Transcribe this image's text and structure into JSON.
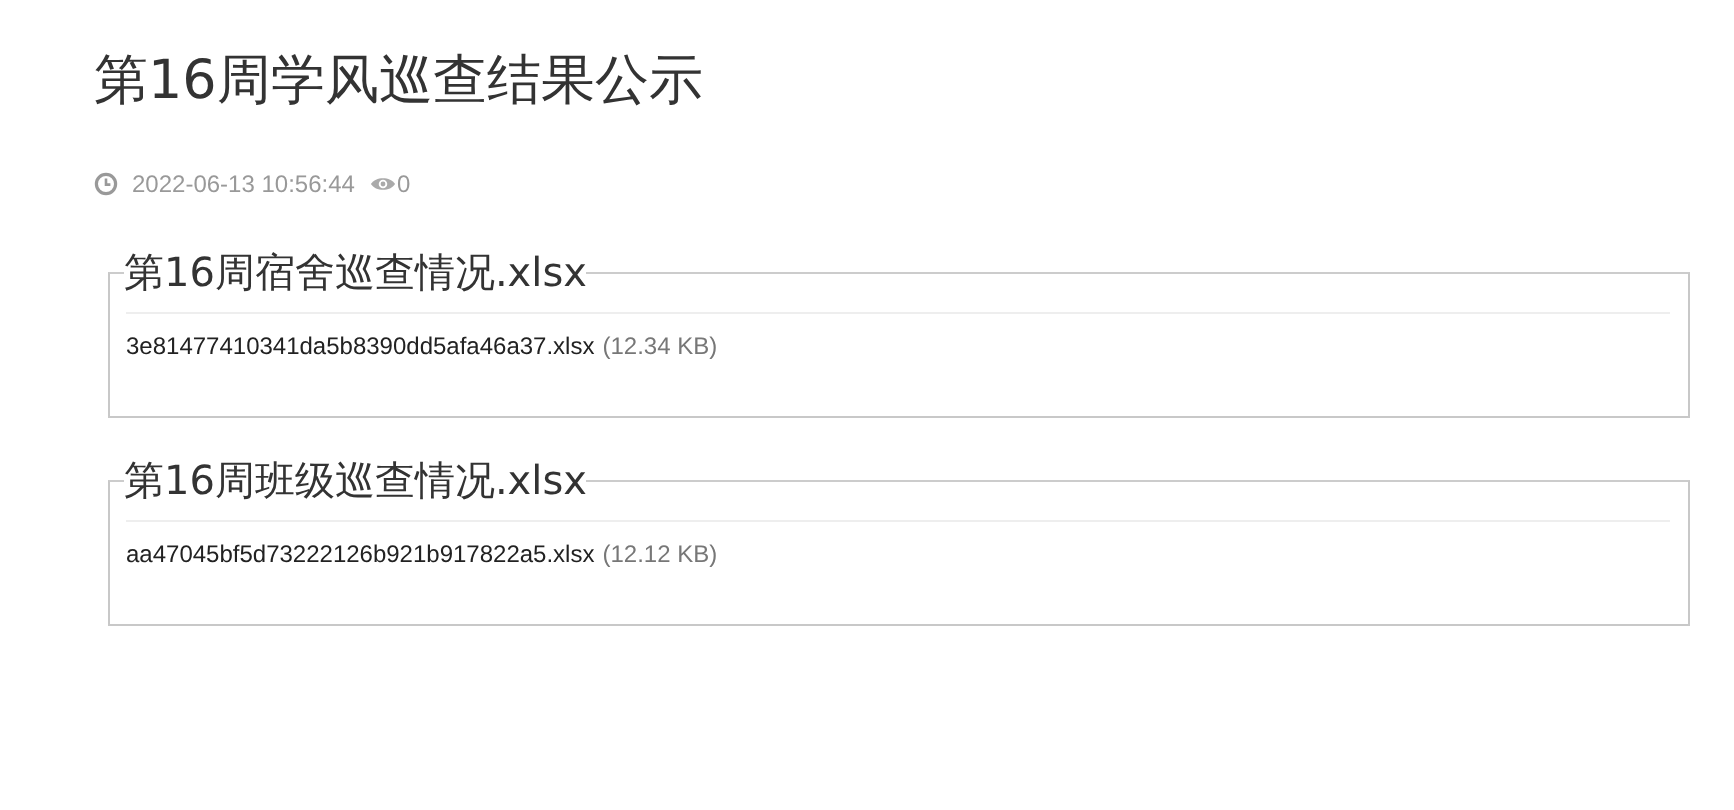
{
  "article": {
    "title": "第16周学风巡查结果公示",
    "date": "2022-06-13 10:56:44",
    "views": "0"
  },
  "attachments": [
    {
      "legend": "第16周宿舍巡查情况.xlsx",
      "file_name": "3e81477410341da5b8390dd5afa46a37.xlsx",
      "size": "(12.34 KB)"
    },
    {
      "legend": "第16周班级巡查情况.xlsx",
      "file_name": "aa47045bf5d73222126b921b917822a5.xlsx",
      "size": "(12.12 KB)"
    }
  ]
}
